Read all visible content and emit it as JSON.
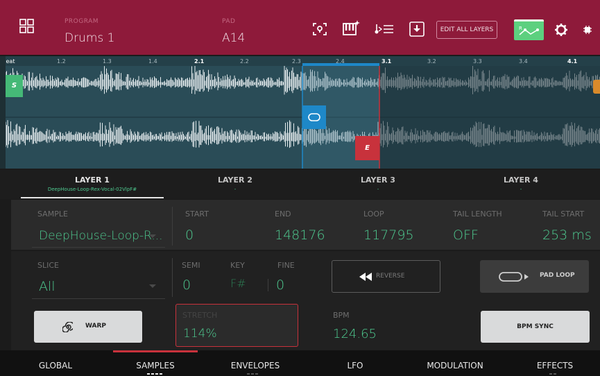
{
  "header": {
    "program_label": "PROGRAM",
    "program_value": "Drums 1",
    "pad_label": "PAD",
    "pad_value": "A14",
    "edit_all_layers": "EDIT ALL LAYERS"
  },
  "ruler": {
    "beat_label": "Beat",
    "ticks": [
      "1.2",
      "1.3",
      "1.4",
      "2.1",
      "2.2",
      "2.3",
      "2.4",
      "3.1",
      "3.2",
      "3.3",
      "3.4",
      "4.1"
    ]
  },
  "waveform": {
    "start_marker": "S",
    "end_marker": "E",
    "loop_marker_icon": "loop-icon"
  },
  "layers": [
    {
      "label": "LAYER 1",
      "sample": "DeepHouse-Loop-Rex-Vocal-02VlpF#"
    },
    {
      "label": "LAYER 2",
      "sample": "-"
    },
    {
      "label": "LAYER 3",
      "sample": "-"
    },
    {
      "label": "LAYER 4",
      "sample": "-"
    }
  ],
  "sample_row": {
    "sample_label": "SAMPLE",
    "sample_value": "DeepHouse-Loop-R...",
    "start_label": "START",
    "start_value": "0",
    "end_label": "END",
    "end_value": "148176",
    "loop_label": "LOOP",
    "loop_value": "117795",
    "tail_length_label": "TAIL LENGTH",
    "tail_length_value": "OFF",
    "tail_start_label": "TAIL START",
    "tail_start_value": "253 ms"
  },
  "lower": {
    "slice_label": "SLICE",
    "slice_value": "All",
    "semi_label": "SEMI",
    "semi_value": "0",
    "key_label": "KEY",
    "key_value": "F#",
    "fine_label": "FINE",
    "fine_value": "0",
    "reverse_label": "REVERSE",
    "pad_loop_label": "PAD LOOP",
    "warp_label": "WARP",
    "stretch_label": "STRETCH",
    "stretch_value": "114%",
    "bpm_label": "BPM",
    "bpm_value": "124.65",
    "bpm_sync_label": "BPM SYNC"
  },
  "nav": [
    "GLOBAL",
    "SAMPLES",
    "ENVELOPES",
    "LFO",
    "MODULATION",
    "EFFECTS"
  ],
  "colors": {
    "header_bg": "#8e1a3a",
    "accent_green": "#4ec98f",
    "waveform_bg": "#2a4c57",
    "loop_blue": "#1e88c8",
    "end_red": "#c8323c"
  }
}
